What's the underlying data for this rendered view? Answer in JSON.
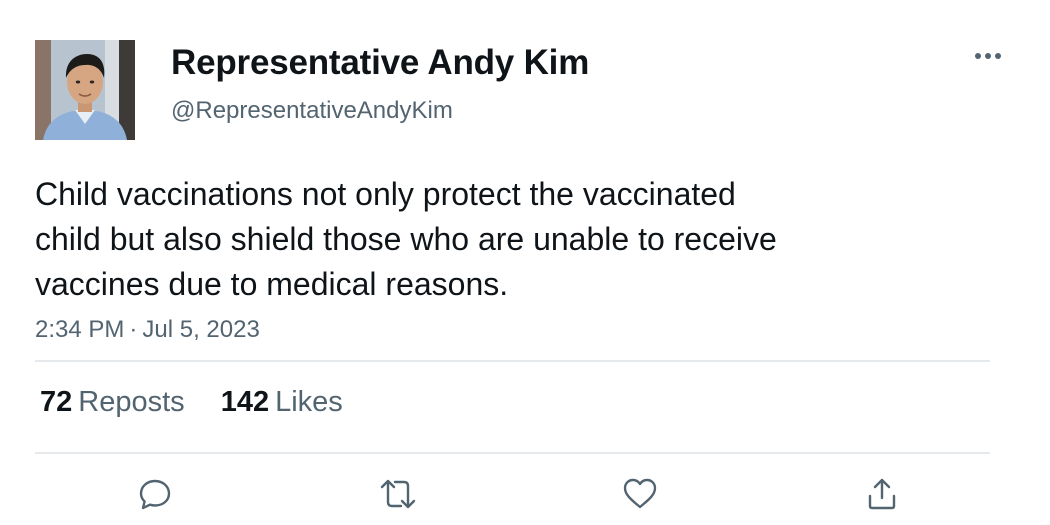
{
  "author": {
    "display_name": "Representative Andy Kim",
    "handle": "@RepresentativeAndyKim"
  },
  "tweet": {
    "text": "Child vaccinations not only protect the vaccinated\nchild but also shield those who are unable to receive\nvaccines due to medical reasons.",
    "time": "2:34 PM",
    "separator": "·",
    "date": "Jul 5, 2023"
  },
  "stats": {
    "reposts_count": "72",
    "reposts_label": "Reposts",
    "likes_count": "142",
    "likes_label": "Likes"
  },
  "icons": {
    "more": "more-horizontal-icon",
    "reply": "reply-icon",
    "repost": "repost-icon",
    "like": "heart-icon",
    "share": "share-icon"
  },
  "colors": {
    "text": "#0f1419",
    "secondary": "#536471",
    "divider": "#e5e9ec"
  }
}
